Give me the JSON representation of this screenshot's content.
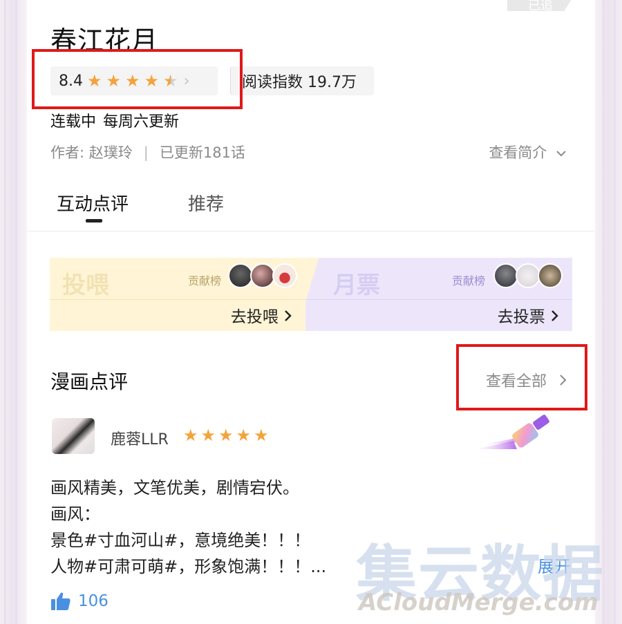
{
  "header": {
    "top_tag": "已追",
    "title": "春江花月",
    "rating": {
      "score": "8.4",
      "stars": 4.5
    },
    "read_index": "阅读指数 19.7万",
    "status": "连载中",
    "schedule": "每周六更新",
    "author": "作者: 赵璞玲",
    "divider": "|",
    "updated": "已更新181话",
    "intro_link": "查看简介"
  },
  "tabs": [
    {
      "label": "互动点评",
      "active": true
    },
    {
      "label": "推荐",
      "active": false
    }
  ],
  "support": {
    "feed": {
      "title": "投喂",
      "rank_label": "贡献榜",
      "action": "去投喂"
    },
    "vote": {
      "title": "月票",
      "rank_label": "贡献榜",
      "action": "去投票"
    }
  },
  "comments": {
    "section_title": "漫画点评",
    "see_all": "查看全部",
    "review": {
      "user": "鹿蓉LLR",
      "stars": 5,
      "lines": [
        "画风精美，文笔优美，剧情宕伏。",
        "画风：",
        "景色#寸血河山#，意境绝美！！！",
        "人物#可肃可萌#，形象饱满！！！..."
      ],
      "expand": "展开",
      "likes": "106"
    }
  },
  "watermark": {
    "cn": "集云数据",
    "en": "ACloudMerge.com"
  },
  "colors": {
    "star": "#f3a33a",
    "highlight_box": "#e01919",
    "link_blue": "#4a90e2"
  }
}
